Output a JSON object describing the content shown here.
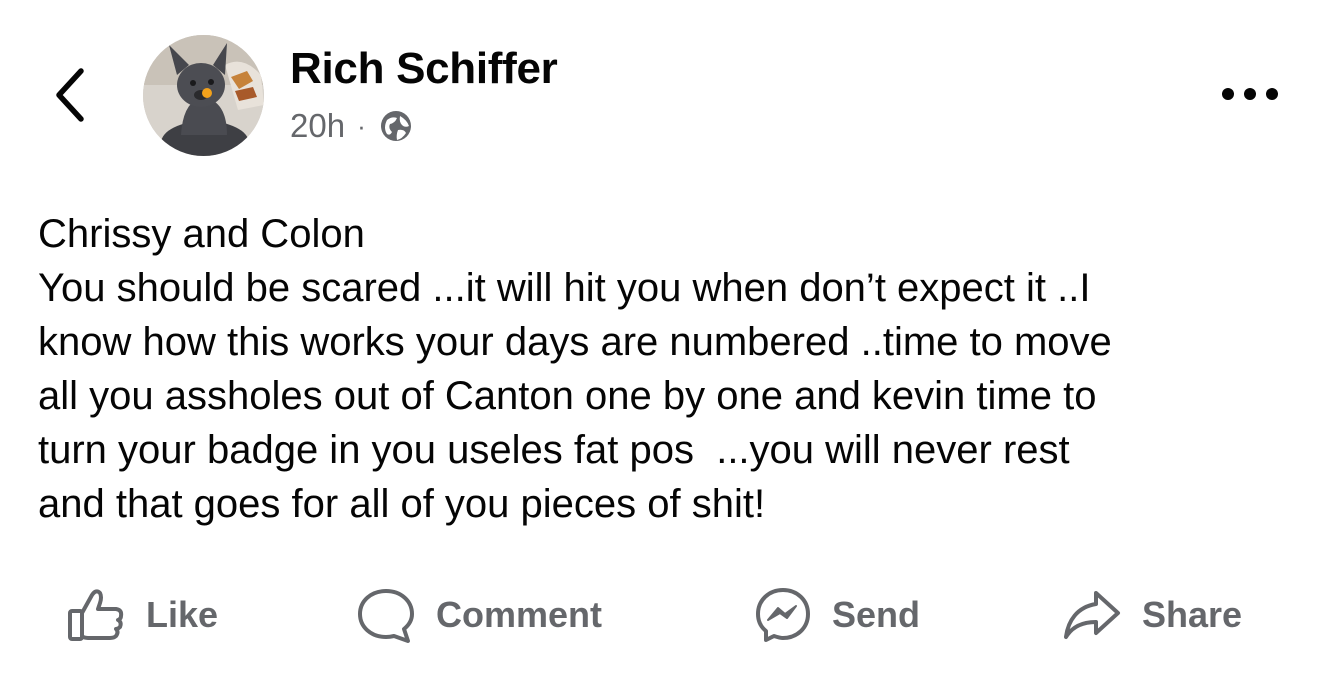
{
  "header": {
    "back_icon": "chevron-left-icon",
    "author_name": "Rich Schiffer",
    "timestamp": "20h",
    "separator": "·",
    "audience_icon": "globe-icon",
    "more_icon": "more-horizontal-icon",
    "avatar": "profile photo of a gray french bulldog"
  },
  "post": {
    "lines": [
      "Chrissy and Colon",
      "You should be scared ...it will hit you when don’t expect it ..I",
      "know how this works your days are numbered ..time to move",
      "all you assholes out of Canton one by one and kevin time to",
      "turn your badge in you useles fat pos  ...you will never rest",
      "and that goes for all of you pieces of shit!"
    ]
  },
  "actions": {
    "like": {
      "label": "Like",
      "icon": "thumbs-up-icon"
    },
    "comment": {
      "label": "Comment",
      "icon": "comment-bubble-icon"
    },
    "send": {
      "label": "Send",
      "icon": "messenger-icon"
    },
    "share": {
      "label": "Share",
      "icon": "share-arrow-icon"
    }
  },
  "colors": {
    "text_primary": "#050505",
    "text_secondary": "#65676b",
    "background": "#ffffff"
  }
}
